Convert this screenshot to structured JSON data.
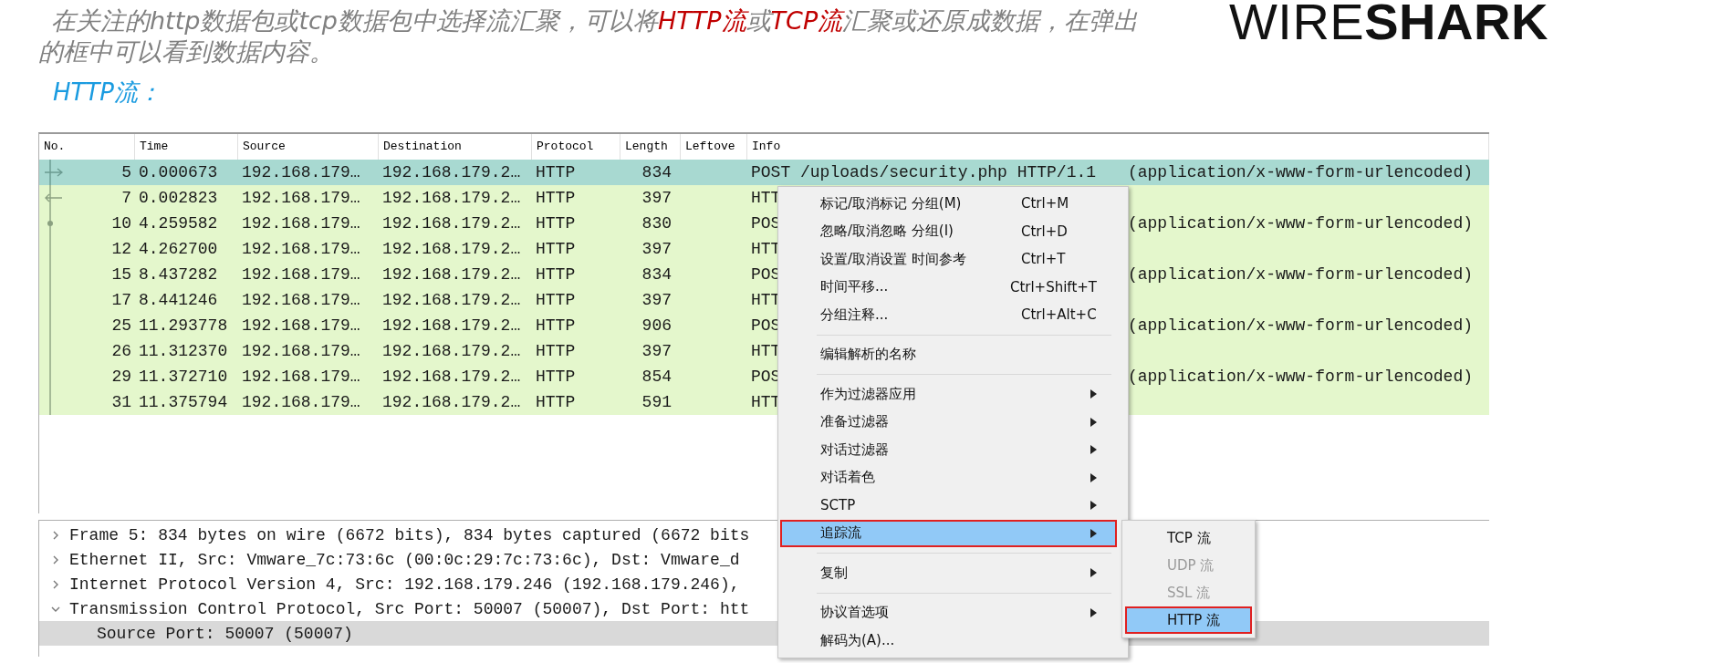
{
  "slide": {
    "intro": [
      {
        "text": "在关注的http数据包或tcp数据包中选择流汇聚，可以将",
        "highlight": false
      },
      {
        "text": "HTTP流",
        "highlight": true
      },
      {
        "text": "或",
        "highlight": false
      },
      {
        "text": "TCP流",
        "highlight": true
      },
      {
        "text": "汇聚或还原成数据，在弹出的框中可以看到数据内容。",
        "highlight": false
      }
    ],
    "subtitle": "HTTP流：",
    "logo": "WIRE**SHARK**"
  },
  "packet_list": {
    "columns": [
      "No.",
      "Time",
      "Source",
      "Destination",
      "Protocol",
      "Length",
      "Leftove",
      "Info"
    ],
    "rows": [
      {
        "no": "5",
        "time": "0.000673",
        "source": "192.168.179…",
        "destination": "192.168.179.2…",
        "protocol": "HTTP",
        "length": "834",
        "info": "POST /uploads/security.php HTTP/1.1",
        "info_tail": "(application/x-www-form-urlencoded)",
        "selected": true,
        "kind": "request"
      },
      {
        "no": "7",
        "time": "0.002823",
        "source": "192.168.179…",
        "destination": "192.168.179.2…",
        "protocol": "HTTP",
        "length": "397",
        "info": "HTT",
        "selected": false,
        "kind": "response"
      },
      {
        "no": "10",
        "time": "4.259582",
        "source": "192.168.179…",
        "destination": "192.168.179.2…",
        "protocol": "HTTP",
        "length": "830",
        "info": "POS",
        "info_tail": "(application/x-www-form-urlencoded)",
        "selected": false,
        "kind": "dot"
      },
      {
        "no": "12",
        "time": "4.262700",
        "source": "192.168.179…",
        "destination": "192.168.179.2…",
        "protocol": "HTTP",
        "length": "397",
        "info": "HTT",
        "selected": false,
        "kind": "line"
      },
      {
        "no": "15",
        "time": "8.437282",
        "source": "192.168.179…",
        "destination": "192.168.179.2…",
        "protocol": "HTTP",
        "length": "834",
        "info": "POS",
        "info_tail": "(application/x-www-form-urlencoded)",
        "selected": false,
        "kind": "line"
      },
      {
        "no": "17",
        "time": "8.441246",
        "source": "192.168.179…",
        "destination": "192.168.179.2…",
        "protocol": "HTTP",
        "length": "397",
        "info": "HTT",
        "selected": false,
        "kind": "line"
      },
      {
        "no": "25",
        "time": "11.293778",
        "source": "192.168.179…",
        "destination": "192.168.179.2…",
        "protocol": "HTTP",
        "length": "906",
        "info": "POS",
        "info_tail": "(application/x-www-form-urlencoded)",
        "selected": false,
        "kind": "line"
      },
      {
        "no": "26",
        "time": "11.312370",
        "source": "192.168.179…",
        "destination": "192.168.179.2…",
        "protocol": "HTTP",
        "length": "397",
        "info": "HTT",
        "selected": false,
        "kind": "line"
      },
      {
        "no": "29",
        "time": "11.372710",
        "source": "192.168.179…",
        "destination": "192.168.179.2…",
        "protocol": "HTTP",
        "length": "854",
        "info": "POS",
        "info_tail": "(application/x-www-form-urlencoded)",
        "selected": false,
        "kind": "line"
      },
      {
        "no": "31",
        "time": "11.375794",
        "source": "192.168.179…",
        "destination": "192.168.179.2…",
        "protocol": "HTTP",
        "length": "591",
        "info": "HTT",
        "selected": false,
        "kind": "line"
      }
    ]
  },
  "details": [
    {
      "text": "Frame 5: 834 bytes on wire (6672 bits), 834 bytes captured (6672 bits",
      "expanded": false,
      "selected": false
    },
    {
      "text": "Ethernet II, Src: Vmware_7c:73:6c (00:0c:29:7c:73:6c), Dst: Vmware_d",
      "expanded": false,
      "selected": false
    },
    {
      "text": "Internet Protocol Version 4, Src: 192.168.179.246 (192.168.179.246),",
      "expanded": false,
      "selected": false
    },
    {
      "text": "Transmission Control Protocol, Src Port: 50007 (50007), Dst Port: htt",
      "expanded": true,
      "selected": false,
      "children": [
        {
          "text": "Source Port: 50007 (50007)",
          "selected": true
        }
      ]
    }
  ],
  "context_menu": {
    "items": [
      {
        "kind": "item",
        "label": "标记/取消标记 分组(M)",
        "shortcut": "Ctrl+M",
        "submenu": false,
        "selected": false,
        "highlighted": false
      },
      {
        "kind": "item",
        "label": "忽略/取消忽略 分组(I)",
        "shortcut": "Ctrl+D",
        "submenu": false,
        "selected": false,
        "highlighted": false
      },
      {
        "kind": "item",
        "label": "设置/取消设置 时间参考",
        "shortcut": "Ctrl+T",
        "submenu": false,
        "selected": false,
        "highlighted": false
      },
      {
        "kind": "item",
        "label": "时间平移...",
        "shortcut": "Ctrl+Shift+T",
        "submenu": false,
        "selected": false,
        "highlighted": false
      },
      {
        "kind": "item",
        "label": "分组注释...",
        "shortcut": "Ctrl+Alt+C",
        "submenu": false,
        "selected": false,
        "highlighted": false
      },
      {
        "kind": "separator"
      },
      {
        "kind": "item",
        "label": "编辑解析的名称",
        "submenu": false,
        "selected": false,
        "highlighted": false
      },
      {
        "kind": "separator"
      },
      {
        "kind": "item",
        "label": "作为过滤器应用",
        "submenu": true,
        "selected": false,
        "highlighted": false
      },
      {
        "kind": "item",
        "label": "准备过滤器",
        "submenu": true,
        "selected": false,
        "highlighted": false
      },
      {
        "kind": "item",
        "label": "对话过滤器",
        "submenu": true,
        "selected": false,
        "highlighted": false
      },
      {
        "kind": "item",
        "label": "对话着色",
        "submenu": true,
        "selected": false,
        "highlighted": false
      },
      {
        "kind": "item",
        "label": "SCTP",
        "submenu": true,
        "selected": false,
        "highlighted": false
      },
      {
        "kind": "item",
        "label": "追踪流",
        "submenu": true,
        "selected": true,
        "highlighted": true
      },
      {
        "kind": "separator"
      },
      {
        "kind": "item",
        "label": "复制",
        "submenu": true,
        "selected": false,
        "highlighted": false
      },
      {
        "kind": "separator"
      },
      {
        "kind": "item",
        "label": "协议首选项",
        "submenu": true,
        "selected": false,
        "highlighted": false
      },
      {
        "kind": "item",
        "label": "解码为(A)...",
        "submenu": false,
        "selected": false,
        "highlighted": false
      }
    ]
  },
  "submenu": {
    "items": [
      {
        "label": "TCP 流",
        "disabled": false,
        "selected": false,
        "highlighted": false
      },
      {
        "label": "UDP 流",
        "disabled": true,
        "selected": false,
        "highlighted": false
      },
      {
        "label": "SSL 流",
        "disabled": true,
        "selected": false,
        "highlighted": false
      },
      {
        "label": "HTTP 流",
        "disabled": false,
        "selected": true,
        "highlighted": true
      }
    ]
  }
}
